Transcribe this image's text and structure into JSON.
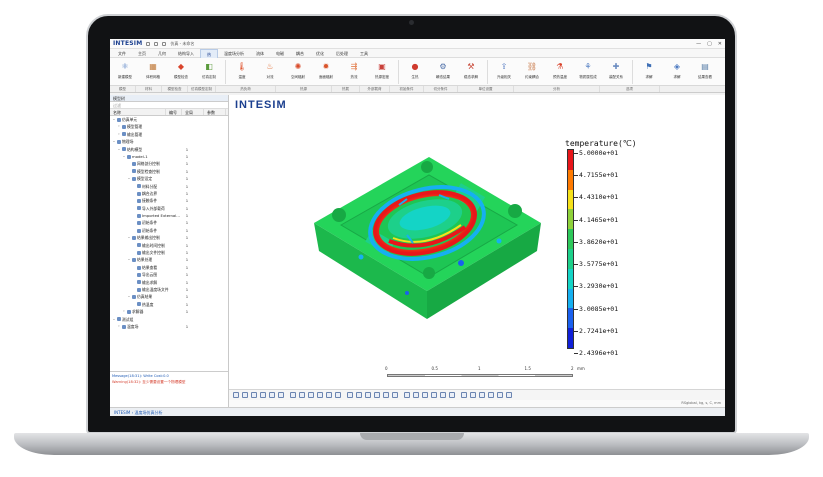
{
  "app": {
    "logo": "INTESIM",
    "window_title": "仿真 - 未命名",
    "window_controls": [
      "—",
      "▢",
      "✕"
    ]
  },
  "menu": [
    "文件",
    "主页",
    "几何",
    "结构导入",
    "热",
    "温度场分析",
    "流体",
    "电磁",
    "耦合",
    "优化",
    "后处理",
    "工具"
  ],
  "menu_active_index": 4,
  "ribbon": {
    "buttons": [
      {
        "label": "新建模型",
        "icon": "atom-icon",
        "color": "#4a78c0",
        "glyph": "⚛"
      },
      {
        "label": "体积网格",
        "icon": "mesh-icon",
        "color": "#c07a3a",
        "glyph": "▦"
      },
      {
        "label": "模型检查",
        "icon": "cube-red-icon",
        "color": "#d9442c",
        "glyph": "◆"
      },
      {
        "label": "仿真定制",
        "icon": "layers-icon",
        "color": "#5a9a3c",
        "glyph": "◧"
      },
      {
        "label": "温度",
        "icon": "thermometer-icon",
        "color": "#e05530",
        "glyph": "🌡"
      },
      {
        "label": "对流",
        "icon": "convection-icon",
        "color": "#e06c30",
        "glyph": "♨"
      },
      {
        "label": "空间辐射",
        "icon": "radiation-icon",
        "color": "#d94c2b",
        "glyph": "✺"
      },
      {
        "label": "面面辐射",
        "icon": "surface-radiation-icon",
        "color": "#d9542b",
        "glyph": "✹"
      },
      {
        "label": "热流",
        "icon": "heat-flux-icon",
        "color": "#e0703a",
        "glyph": "⇶"
      },
      {
        "label": "热源密度",
        "icon": "heat-source-icon",
        "color": "#c9403a",
        "glyph": "▣"
      },
      {
        "label": "生热",
        "icon": "sphere-icon",
        "color": "#cf3a2e",
        "glyph": "●"
      },
      {
        "label": "瞬态结果",
        "icon": "result-icon",
        "color": "#4d6fa8",
        "glyph": "⚙"
      },
      {
        "label": "稳态求解",
        "icon": "solve-icon",
        "color": "#c94a3a",
        "glyph": "⚒"
      },
      {
        "label": "升级相关",
        "icon": "upgrade-icon",
        "color": "#5a7fc4",
        "glyph": "⇪"
      },
      {
        "label": "约束耦合",
        "icon": "coupling-icon",
        "color": "#c97a4a",
        "glyph": "⛓"
      },
      {
        "label": "预热温度",
        "icon": "preheat-icon",
        "color": "#d9442c",
        "glyph": "⚗"
      },
      {
        "label": "物质属性成",
        "icon": "material-icon",
        "color": "#4a78c0",
        "glyph": "⚘"
      },
      {
        "label": "装配关系",
        "icon": "assembly-icon",
        "color": "#6a8bc0",
        "glyph": "✚"
      },
      {
        "label": "求解",
        "icon": "solve-run-icon",
        "color": "#3e6fb5",
        "glyph": "⚑"
      },
      {
        "label": "求解",
        "icon": "compute-icon",
        "color": "#4a78c0",
        "glyph": "◈"
      },
      {
        "label": "结果查看",
        "icon": "view-results-icon",
        "color": "#5a7fa8",
        "glyph": "▤"
      }
    ],
    "groups": [
      "模型",
      "材料",
      "模型检查",
      "仿真模型定制",
      "热负荷",
      "热源",
      "热载",
      "外部载荷",
      "初始条件",
      "切分条件",
      "单位设置",
      "分析",
      "选项"
    ]
  },
  "left_panel": {
    "tab": "模型树",
    "filter_placeholder": "过滤",
    "columns": [
      "名称",
      "编号",
      "全局",
      "参数"
    ],
    "tree": [
      {
        "indent": 0,
        "arrow": "⌄",
        "name": "仿真单元",
        "num": ""
      },
      {
        "indent": 1,
        "arrow": "›",
        "name": "模型管理",
        "num": ""
      },
      {
        "indent": 1,
        "arrow": "›",
        "name": "输出管理",
        "num": ""
      },
      {
        "indent": 0,
        "arrow": "⌄",
        "name": "物理场",
        "num": ""
      },
      {
        "indent": 1,
        "arrow": "⌄",
        "name": "结构模型",
        "num": "1"
      },
      {
        "indent": 2,
        "arrow": "⌄",
        "name": "model-1",
        "num": "1"
      },
      {
        "indent": 3,
        "arrow": "",
        "name": "网格剖分控制",
        "num": "1"
      },
      {
        "indent": 3,
        "arrow": "",
        "name": "模型检查控制",
        "num": "1"
      },
      {
        "indent": 3,
        "arrow": "⌄",
        "name": "模型设定",
        "num": "1"
      },
      {
        "indent": 4,
        "arrow": "",
        "name": "材料分配",
        "num": "1"
      },
      {
        "indent": 4,
        "arrow": "",
        "name": "耦合边界",
        "num": "1"
      },
      {
        "indent": 4,
        "arrow": "",
        "name": "接触条件",
        "num": "1"
      },
      {
        "indent": 4,
        "arrow": "",
        "name": "导入外部载荷",
        "num": "1"
      },
      {
        "indent": 4,
        "arrow": "",
        "name": "Imported External...",
        "num": "1"
      },
      {
        "indent": 4,
        "arrow": "",
        "name": "初始条件",
        "num": "1"
      },
      {
        "indent": 4,
        "arrow": "",
        "name": "初始条件",
        "num": "1"
      },
      {
        "indent": 3,
        "arrow": "⌄",
        "name": "结果输出控制",
        "num": "1"
      },
      {
        "indent": 4,
        "arrow": "",
        "name": "输出时间控制",
        "num": "1"
      },
      {
        "indent": 4,
        "arrow": "",
        "name": "输出文件控制",
        "num": "1"
      },
      {
        "indent": 3,
        "arrow": "⌄",
        "name": "结果处理",
        "num": "1"
      },
      {
        "indent": 4,
        "arrow": "",
        "name": "结果查看",
        "num": "1"
      },
      {
        "indent": 4,
        "arrow": "",
        "name": "导出云图",
        "num": "1"
      },
      {
        "indent": 4,
        "arrow": "",
        "name": "输出求解",
        "num": "1"
      },
      {
        "indent": 4,
        "arrow": "",
        "name": "输出温度场文件",
        "num": "1"
      },
      {
        "indent": 3,
        "arrow": "⌄",
        "name": "仿真结果",
        "num": "1"
      },
      {
        "indent": 4,
        "arrow": "",
        "name": "热温度",
        "num": "1"
      },
      {
        "indent": 2,
        "arrow": "›",
        "name": "求解器",
        "num": "1"
      },
      {
        "indent": 0,
        "arrow": "⌄",
        "name": "测试组",
        "num": ""
      },
      {
        "indent": 1,
        "arrow": "›",
        "name": "温度场",
        "num": "1"
      }
    ],
    "messages": [
      {
        "text": "Message(18:31): Write Cost:0.0",
        "kind": "info"
      },
      {
        "text": "Warning(18:32): 至少需要设置一个物理模型",
        "kind": "warn"
      }
    ]
  },
  "viewport": {
    "brand": "INTESIM",
    "legend_title": "temperature(℃)",
    "legend_labels": [
      "5.0000e+01",
      "4.7155e+01",
      "4.4310e+01",
      "4.1465e+01",
      "3.8620e+01",
      "3.5775e+01",
      "3.2930e+01",
      "3.0085e+01",
      "2.7241e+01",
      "2.4396e+01"
    ],
    "legend_colors": [
      "#e8161a",
      "#ff7a00",
      "#f6e11a",
      "#8fd23a",
      "#2dc85a",
      "#1dd08a",
      "#14d4c6",
      "#16b0f0",
      "#1a60ee",
      "#1020d8"
    ],
    "scale_labels": [
      "0",
      "0.5",
      "1",
      "1.5",
      "2"
    ],
    "scale_unit": "mm",
    "coord_status": "RSglobal, kg, s, C, mm"
  },
  "status_bar": "INTESIM  ›  温度场仿真分析"
}
